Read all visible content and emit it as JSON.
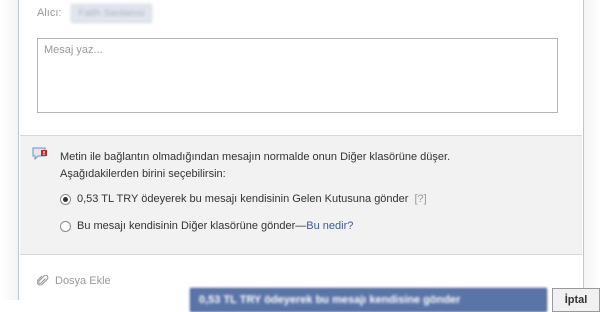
{
  "compose": {
    "to_label": "Alıcı:",
    "recipient": "Fatih Sanlamsi",
    "message_placeholder": "Mesaj yaz..."
  },
  "delivery_options": {
    "notice_line1": "Metin ile bağlantın olmadığından mesajın normalde onun Diğer klasörüne düşer.",
    "notice_line2": "Aşağıdakilerden birini seçebilirsin:",
    "option_paid_label": "0,53 TL TRY ödeyerek bu mesajı kendisinin Gelen Kutusuna gönder",
    "option_paid_help": "[?]",
    "option_other_label": "Bu mesajı kendisinin Diğer klasörüne gönder—",
    "option_other_link": "Bu nedir?",
    "selected": "paid"
  },
  "footer": {
    "attach_label": "Dosya Ekle",
    "send_label": "0,53 TL TRY ödeyerek bu mesajı kendisine gönder",
    "cancel_label": "İptal"
  },
  "colors": {
    "link": "#3b5998",
    "send_button": "#5b74a8",
    "panel_bg": "#f2f2f2"
  },
  "icons": {
    "notice": "speech-bubble-warning-icon",
    "attach": "paperclip-icon"
  }
}
